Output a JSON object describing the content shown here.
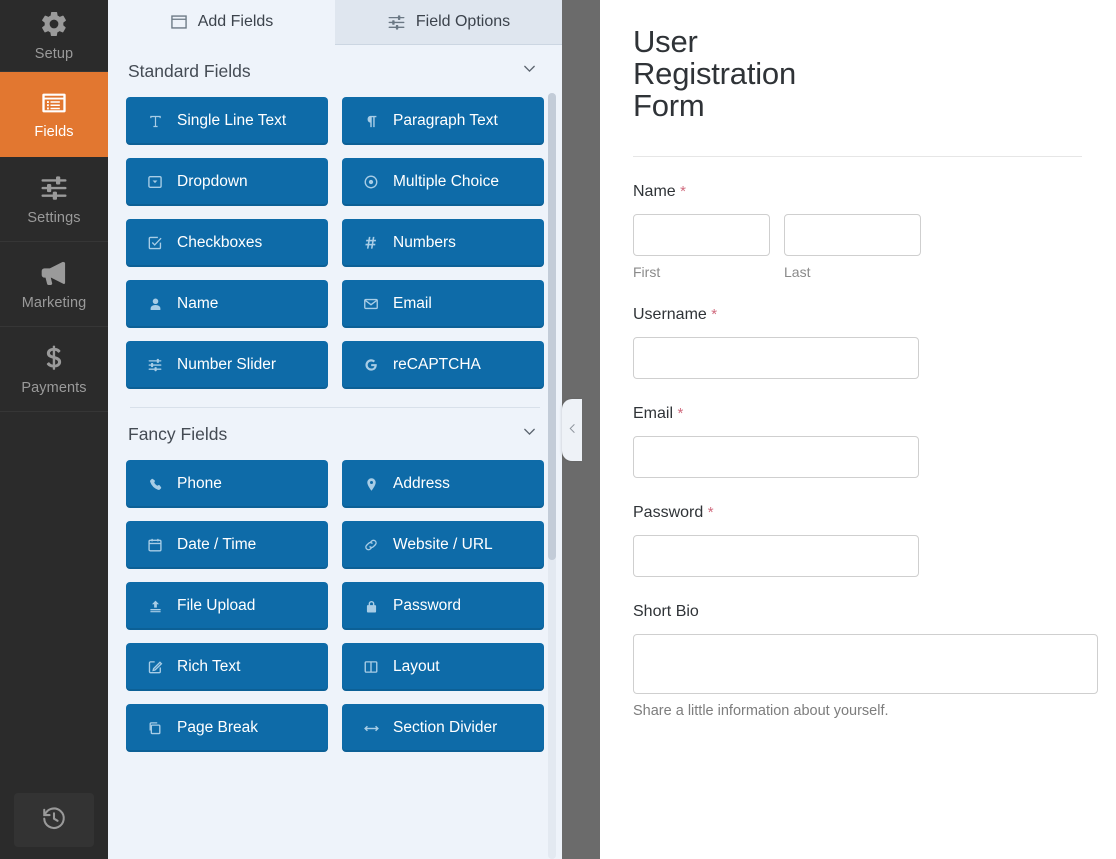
{
  "sidebar": {
    "items": [
      {
        "label": "Setup",
        "icon": "gear-icon",
        "active": false
      },
      {
        "label": "Fields",
        "icon": "list-icon",
        "active": true
      },
      {
        "label": "Settings",
        "icon": "sliders-icon",
        "active": false
      },
      {
        "label": "Marketing",
        "icon": "megaphone-icon",
        "active": false
      },
      {
        "label": "Payments",
        "icon": "dollar-icon",
        "active": false
      }
    ],
    "bottom_button": {
      "name": "revisions-button",
      "icon": "history-icon"
    },
    "active_color": "#e27730",
    "background_color": "#2b2b2b"
  },
  "panel": {
    "tabs": [
      {
        "label": "Add Fields",
        "icon": "add-fields-icon",
        "active": true
      },
      {
        "label": "Field Options",
        "icon": "field-options-icon",
        "active": false
      }
    ],
    "sections": [
      {
        "title": "Standard Fields",
        "collapsed": false,
        "fields": [
          {
            "label": "Single Line Text",
            "icon": "text-cursor-icon"
          },
          {
            "label": "Paragraph Text",
            "icon": "pilcrow-icon"
          },
          {
            "label": "Dropdown",
            "icon": "dropdown-icon"
          },
          {
            "label": "Multiple Choice",
            "icon": "radio-icon"
          },
          {
            "label": "Checkboxes",
            "icon": "checkbox-icon"
          },
          {
            "label": "Numbers",
            "icon": "hash-icon"
          },
          {
            "label": "Name",
            "icon": "user-icon"
          },
          {
            "label": "Email",
            "icon": "envelope-icon"
          },
          {
            "label": "Number Slider",
            "icon": "slider-icon"
          },
          {
            "label": "reCAPTCHA",
            "icon": "google-g-icon"
          }
        ]
      },
      {
        "title": "Fancy Fields",
        "collapsed": false,
        "fields": [
          {
            "label": "Phone",
            "icon": "phone-icon"
          },
          {
            "label": "Address",
            "icon": "map-pin-icon"
          },
          {
            "label": "Date / Time",
            "icon": "calendar-icon"
          },
          {
            "label": "Website / URL",
            "icon": "link-icon"
          },
          {
            "label": "File Upload",
            "icon": "upload-icon"
          },
          {
            "label": "Password",
            "icon": "lock-icon"
          },
          {
            "label": "Rich Text",
            "icon": "pencil-square-icon"
          },
          {
            "label": "Layout",
            "icon": "columns-icon"
          },
          {
            "label": "Page Break",
            "icon": "pages-icon"
          },
          {
            "label": "Section Divider",
            "icon": "arrows-horizontal-icon"
          }
        ]
      }
    ],
    "field_button_color": "#0e6ba8",
    "background_color": "#eef3fa"
  },
  "collapse_handle": {
    "icon": "chevron-left-icon"
  },
  "preview": {
    "form_title": "User Registration Form",
    "required_marker": "*",
    "fields": [
      {
        "label": "Name",
        "required": true,
        "type": "name",
        "subfields": [
          {
            "sublabel": "First",
            "value": ""
          },
          {
            "sublabel": "Last",
            "value": ""
          }
        ]
      },
      {
        "label": "Username",
        "required": true,
        "type": "text",
        "value": ""
      },
      {
        "label": "Email",
        "required": true,
        "type": "email",
        "value": ""
      },
      {
        "label": "Password",
        "required": true,
        "type": "password",
        "value": ""
      },
      {
        "label": "Short Bio",
        "required": false,
        "type": "textarea",
        "value": "",
        "hint": "Share a little information about yourself."
      }
    ]
  }
}
